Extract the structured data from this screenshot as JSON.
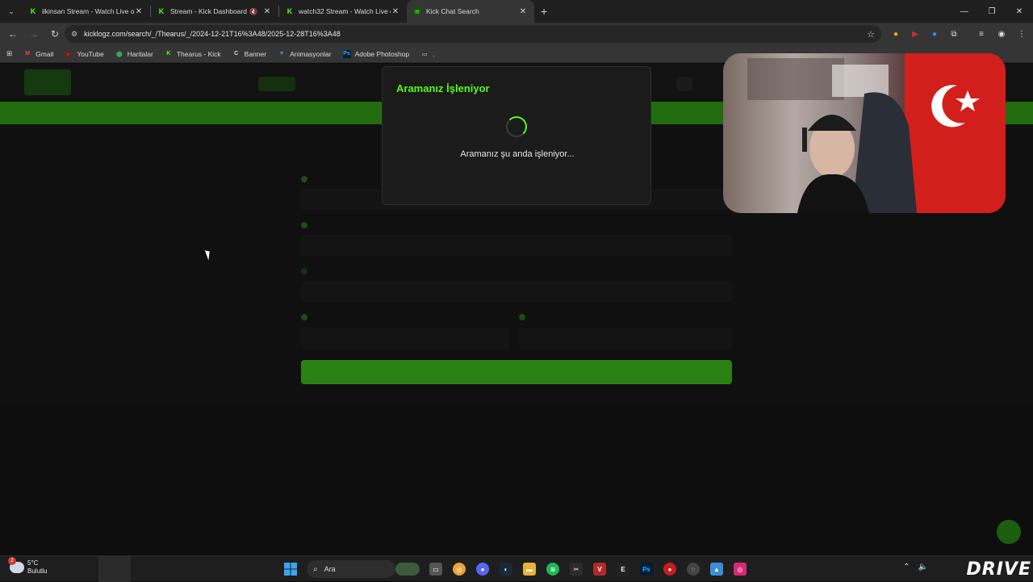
{
  "browser": {
    "tabs": [
      {
        "title": "ilkinsan Stream - Watch Live on",
        "favicon": "kick-icon",
        "active": false
      },
      {
        "title": "Stream - Kick Dashboard",
        "favicon": "kick-icon",
        "active": false,
        "muted": true
      },
      {
        "title": "watch32 Stream - Watch Live o",
        "favicon": "kick-icon",
        "active": false
      },
      {
        "title": "Kick Chat Search",
        "favicon": "kicklogz-icon",
        "active": true
      }
    ],
    "url": "kicklogz.com/search/_/Thearus/_/2024-12-21T16%3A48/2025-12-28T16%3A48",
    "bookmarks": [
      {
        "label": "Gmail",
        "icon": "gmail-icon"
      },
      {
        "label": "YouTube",
        "icon": "youtube-icon"
      },
      {
        "label": "Haritalar",
        "icon": "maps-icon"
      },
      {
        "label": "Thearus - Kick",
        "icon": "kick-icon"
      },
      {
        "label": "Banner",
        "icon": "canva-icon"
      },
      {
        "label": "Animasyonlar",
        "icon": "vector-icon"
      },
      {
        "label": "Adobe Photoshop",
        "icon": "photoshop-icon"
      },
      {
        "label": ".",
        "icon": "folder-icon"
      }
    ]
  },
  "modal": {
    "title": "Aramanız İşleniyor",
    "message": "Aramanız şu anda işleniyor..."
  },
  "taskbar": {
    "weather_temp": "5°C",
    "weather_desc": "Bulutlu",
    "weather_badge": "2",
    "search_label": "Ara",
    "brand_overlay": "DRIVE"
  },
  "colors": {
    "accent": "#53fc18",
    "modal_bg": "#1b1b1b",
    "page_bg": "#0e0e0e"
  }
}
